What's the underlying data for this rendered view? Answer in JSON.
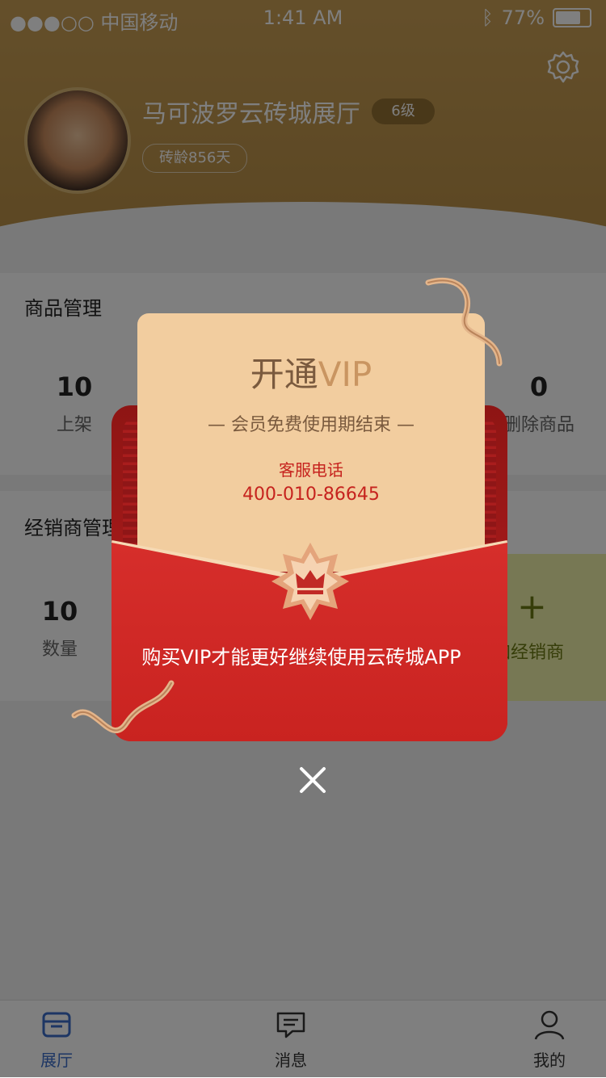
{
  "status_bar": {
    "carrier": "●●●○○ 中国移动",
    "time": "1:41 AM",
    "battery": "77%"
  },
  "profile": {
    "store_name": "马可波罗云砖城展厅",
    "level": "6级",
    "age": "砖龄856天"
  },
  "products": {
    "title": "商品管理",
    "stats": [
      {
        "value": "10",
        "label": "上架"
      },
      {
        "value": "0",
        "label": "删除商品"
      }
    ]
  },
  "dealers": {
    "title": "经销商管理",
    "stats": [
      {
        "value": "10",
        "label": "数量"
      }
    ],
    "add_label": "加经销商",
    "add_symbol": "+"
  },
  "vip_popup": {
    "title_prefix": "开通",
    "title_vip": "VIP",
    "subtitle": "— 会员免费使用期结束 —",
    "phone_label": "客服电话",
    "phone": "400-010-86645",
    "message": "购买VIP才能更好继续使用云砖城APP"
  },
  "tabs": [
    {
      "label": "展厅",
      "icon": "store-icon",
      "active": true
    },
    {
      "label": "消息",
      "icon": "message-icon",
      "active": false
    },
    {
      "label": "我的",
      "icon": "user-icon",
      "active": false
    }
  ],
  "colors": {
    "header": "#c49a52",
    "envelope_red": "#c92320",
    "letter": "#f2cd9f",
    "tab_active": "#3a6cc8"
  }
}
